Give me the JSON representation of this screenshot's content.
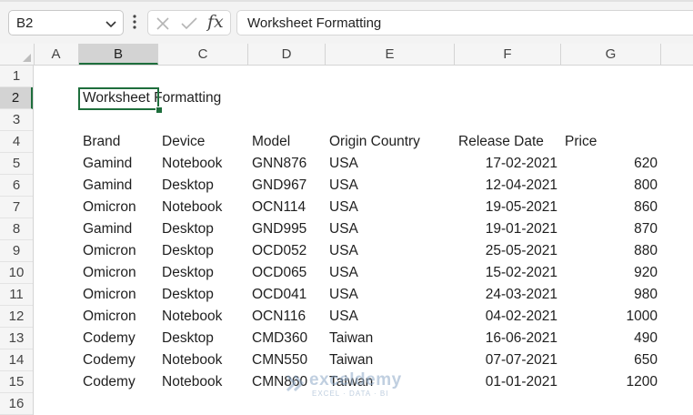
{
  "name_box": {
    "value": "B2"
  },
  "formula_bar": {
    "value": "Worksheet Formatting",
    "fx_label": "fx"
  },
  "columns": [
    "A",
    "B",
    "C",
    "D",
    "E",
    "F",
    "G"
  ],
  "rows": [
    "1",
    "2",
    "3",
    "4",
    "5",
    "6",
    "7",
    "8",
    "9",
    "10",
    "11",
    "12",
    "13",
    "14",
    "15",
    "16"
  ],
  "selected": {
    "column": "B",
    "row": "2"
  },
  "title_cell": "Worksheet Formatting",
  "headers": [
    "Brand",
    "Device",
    "Model",
    "Origin Country",
    "Release Date",
    "Price"
  ],
  "data_rows": [
    [
      "Gamind",
      "Notebook",
      "GNN876",
      "USA",
      "17-02-2021",
      "620"
    ],
    [
      "Gamind",
      "Desktop",
      "GND967",
      "USA",
      "12-04-2021",
      "800"
    ],
    [
      "Omicron",
      "Notebook",
      "OCN114",
      "USA",
      "19-05-2021",
      "860"
    ],
    [
      "Gamind",
      "Desktop",
      "GND995",
      "USA",
      "19-01-2021",
      "870"
    ],
    [
      "Omicron",
      "Desktop",
      "OCD052",
      "USA",
      "25-05-2021",
      "880"
    ],
    [
      "Omicron",
      "Desktop",
      "OCD065",
      "USA",
      "15-02-2021",
      "920"
    ],
    [
      "Omicron",
      "Desktop",
      "OCD041",
      "USA",
      "24-03-2021",
      "980"
    ],
    [
      "Omicron",
      "Notebook",
      "OCN116",
      "USA",
      "04-02-2021",
      "1000"
    ],
    [
      "Codemy",
      "Desktop",
      "CMD360",
      "Taiwan",
      "16-06-2021",
      "490"
    ],
    [
      "Codemy",
      "Notebook",
      "CMN550",
      "Taiwan",
      "07-07-2021",
      "650"
    ],
    [
      "Codemy",
      "Notebook",
      "CMN860",
      "Taiwan",
      "01-01-2021",
      "1200"
    ]
  ],
  "watermark": {
    "title": "exceldemy",
    "subtitle": "EXCEL · DATA · BI"
  },
  "colors": {
    "selection": "#1e6e3c",
    "header_bg": "#f5f5f5",
    "selected_header_bg": "#d3d3d3"
  }
}
